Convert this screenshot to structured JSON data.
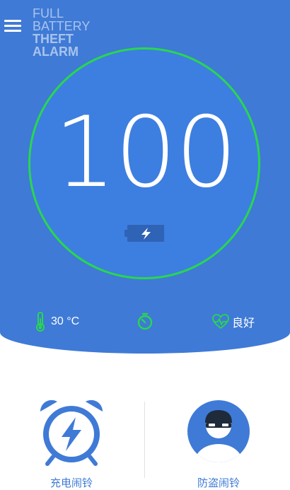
{
  "app": {
    "logo_line1": "FULL",
    "logo_line2": "BATTERY",
    "logo_line3": "THEFT",
    "logo_line4": "ALARM"
  },
  "battery": {
    "level": "100",
    "charging": true
  },
  "stats": {
    "temperature": "30 °C",
    "health": "良好"
  },
  "features": [
    {
      "label": "充电闹铃",
      "icon": "alarm-clock-icon"
    },
    {
      "label": "防盗闹铃",
      "icon": "thief-icon"
    }
  ],
  "colors": {
    "primary": "#3f7ad6",
    "ring": "#28d74f",
    "accent_green": "#28d74f",
    "white": "#ffffff"
  }
}
